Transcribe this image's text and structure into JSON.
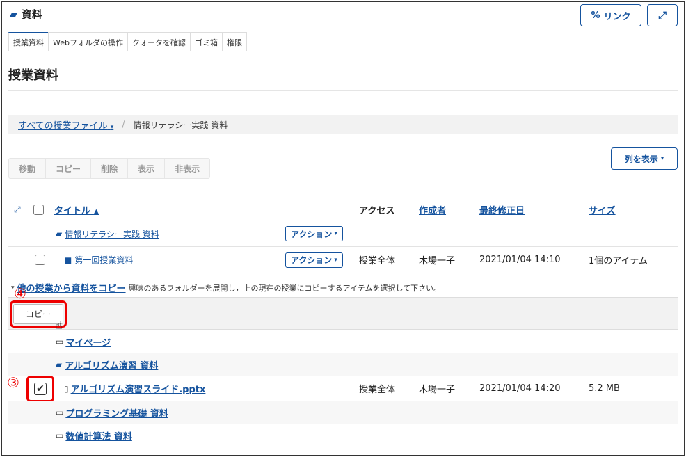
{
  "header": {
    "title": "資料",
    "link_label": "リンク",
    "expand_icon": "expand-icon"
  },
  "tabs": [
    "授業資料",
    "Webフォルダの操作",
    "クォータを確認",
    "ゴミ箱",
    "権限"
  ],
  "page_title": "授業資料",
  "breadcrumb": {
    "root": "すべての授業ファイル",
    "current": "情報リテラシー実践 資料"
  },
  "toolbar": {
    "buttons": [
      "移動",
      "コピー",
      "削除",
      "表示",
      "非表示"
    ],
    "columns_label": "列を表示"
  },
  "table": {
    "headers": {
      "title": "タイトル",
      "access": "アクセス",
      "author": "作成者",
      "modified": "最終修正日",
      "size": "サイズ"
    },
    "rows": [
      {
        "title": "情報リテラシー実践 資料",
        "action": "アクション",
        "access": "",
        "author": "",
        "modified": "",
        "size": ""
      },
      {
        "title": "第一回授業資料",
        "action": "アクション",
        "access": "授業全体",
        "author": "木場一子",
        "modified": "2021/01/04 14:10",
        "size": "1個のアイテム"
      }
    ]
  },
  "copy_section": {
    "link": "他の授業から資料をコピー",
    "description": "興味のあるフォルダーを展開し，上の現在の授業にコピーするアイテムを選択して下さい。",
    "copy_button": "コピー",
    "step_copy": "④",
    "step_check": "③",
    "items": [
      {
        "label": "マイページ"
      },
      {
        "label": "アルゴリズム演習 資料"
      },
      {
        "label": "アルゴリズム演習スライド.pptx",
        "access": "授業全体",
        "author": "木場一子",
        "modified": "2021/01/04 14:20",
        "size": "5.2 MB"
      },
      {
        "label": "プログラミング基礎 資料"
      },
      {
        "label": "数値計算法 資料"
      }
    ]
  },
  "colors": {
    "accent": "#15539e",
    "highlight": "#e00000"
  }
}
